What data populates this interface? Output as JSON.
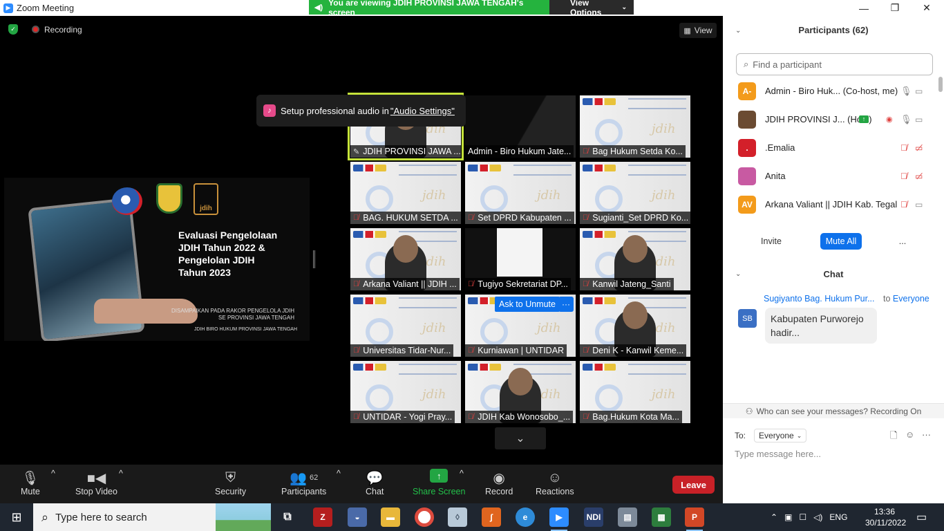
{
  "window": {
    "title": "Zoom Meeting",
    "share_banner": "You are viewing JDIH PROVINSI JAWA TENGAH's screen",
    "view_options": "View Options"
  },
  "status": {
    "recording": "Recording",
    "view": "View"
  },
  "toast": {
    "text": "Setup professional audio in ",
    "link": "\"Audio Settings\""
  },
  "slide": {
    "title": "Evaluasi Pengelolaan\nJDIH Tahun 2022 &\nPengelolan JDIH\n Tahun 2023",
    "line1": "DISAMPAIKAN PADA RAKOR PENGELOLA JDIH",
    "line2": "SE PROVINSI JAWA TENGAH",
    "line3": "JDIH BIRO HUKUM PROVINSI JAWA TENGAH",
    "logo_text": "jdih"
  },
  "tiles": [
    {
      "label": "JDIH PROVINSI JAWA ..."
    },
    {
      "label": "Admin - Biro Hukum Jate..."
    },
    {
      "label": "Bag Hukum Setda Ko..."
    },
    {
      "label": "BAG. HUKUM SETDA ..."
    },
    {
      "label": "Set DPRD Kabupaten ..."
    },
    {
      "label": "Sugianti_Set DPRD Ko..."
    },
    {
      "label": "Arkana Valiant || JDIH ..."
    },
    {
      "label": "Tugiyo Sekretariat DP..."
    },
    {
      "label": "Kanwil Jateng_Santi"
    },
    {
      "label": "Universitas Tidar-Nur..."
    },
    {
      "label": "Kurniawan | UNTIDAR"
    },
    {
      "label": "Deni K - Kanwil Keme..."
    },
    {
      "label": "UNTIDAR - Yogi Pray..."
    },
    {
      "label": "JDIH Kab Wonosobo_..."
    },
    {
      "label": "Bag.Hukum Kota Ma..."
    }
  ],
  "tile_watermark": "jdih",
  "ask_unmute": "Ask to Unmute",
  "toolbar": {
    "mute": "Mute",
    "stop_video": "Stop Video",
    "security": "Security",
    "participants": "Participants",
    "participants_count": "62",
    "chat": "Chat",
    "share_screen": "Share Screen",
    "record": "Record",
    "reactions": "Reactions",
    "leave": "Leave"
  },
  "participants": {
    "header": "Participants (62)",
    "search_placeholder": "Find a participant",
    "list": [
      {
        "initials": "A-",
        "name": "Admin - Biro Huk... (Co-host, me)",
        "color": "#f39b1b"
      },
      {
        "initials": "",
        "name": "JDIH PROVINSI J... (Host)",
        "color": "#6b4b32"
      },
      {
        "initials": ".",
        "name": ".Emalia",
        "color": "#d3202a"
      },
      {
        "initials": "",
        "name": "Anita",
        "color": "#c85aa2"
      },
      {
        "initials": "AV",
        "name": "Arkana Valiant || JDIH Kab. Tegal",
        "color": "#f39b1b"
      }
    ],
    "invite": "Invite",
    "mute_all": "Mute All",
    "more": "..."
  },
  "chat": {
    "header": "Chat",
    "from": "Sugiyanto Bag. Hukum Pur...",
    "to_prefix": "to",
    "to": "Everyone",
    "sender_initials": "SB",
    "message": "Kabupaten Purworejo hadir...",
    "who_can_see": "Who can see your messages? Recording On",
    "to_label": "To:",
    "recipient": "Everyone",
    "input_placeholder": "Type message here..."
  },
  "taskbar": {
    "search": "Type here to search",
    "lang": "ENG",
    "time": "13:36",
    "date": "30/11/2022"
  }
}
